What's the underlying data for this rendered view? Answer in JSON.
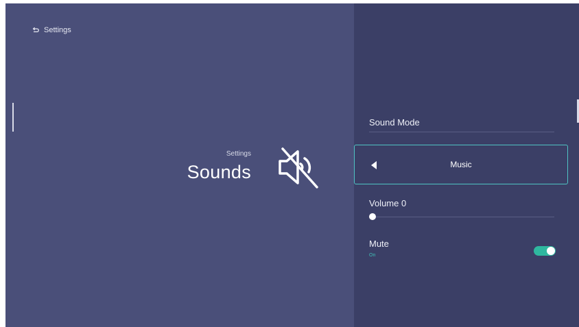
{
  "header": {
    "back_label": "Settings"
  },
  "hero": {
    "breadcrumb": "Settings",
    "title": "Sounds",
    "icon": "volume-mute-icon"
  },
  "settings": {
    "sound_mode": {
      "label": "Sound Mode",
      "value": "Music"
    },
    "volume": {
      "label": "Volume 0",
      "value": 0,
      "max": 100
    },
    "mute": {
      "label": "Mute",
      "state": "On",
      "enabled": true
    }
  },
  "colors": {
    "left_panel": "#4a4f79",
    "right_panel": "#3b3f66",
    "accent": "#4fc4c4",
    "toggle_on": "#2fb79f"
  }
}
